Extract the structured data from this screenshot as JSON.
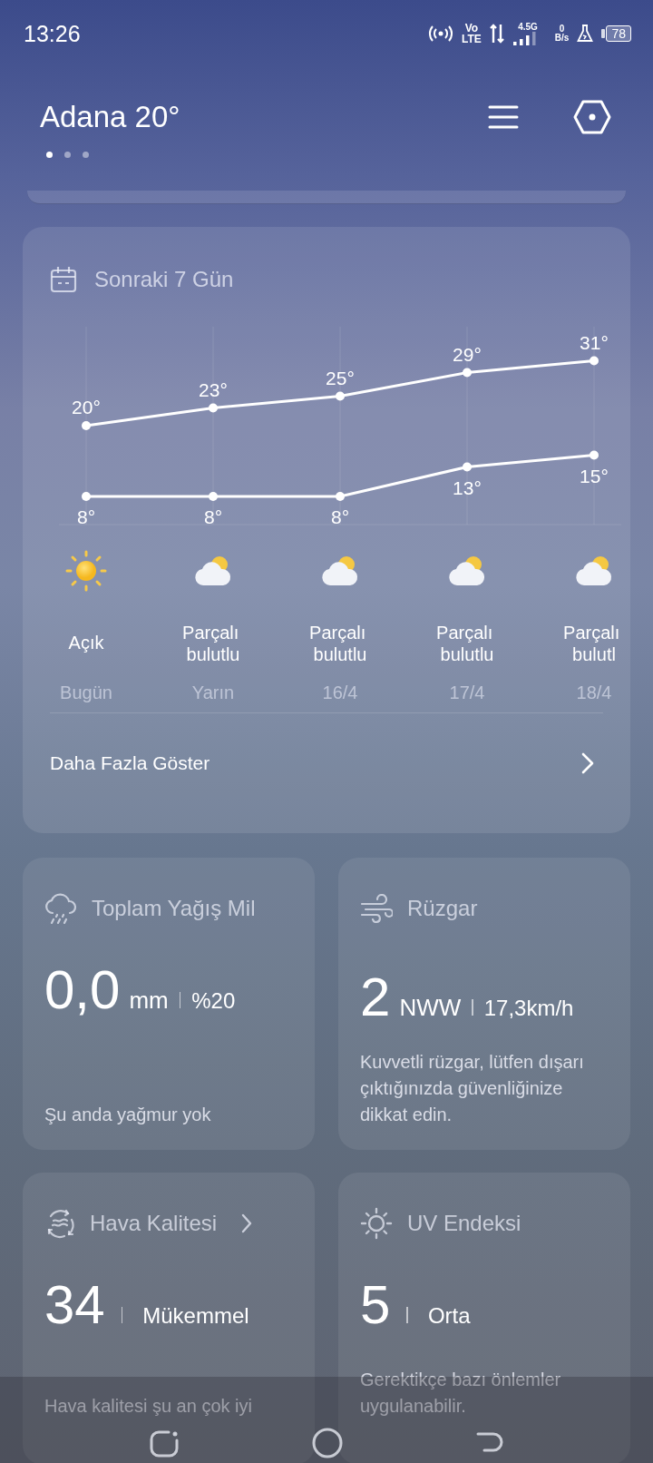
{
  "status_bar": {
    "time": "13:26",
    "volte_top": "Vo",
    "volte_bottom": "LTE",
    "network": "4.5G",
    "speed_value": "0",
    "speed_unit": "B/s",
    "battery": "78"
  },
  "header": {
    "title": "Adana 20°",
    "pages": [
      {
        "selected": true
      },
      {
        "selected": false
      },
      {
        "selected": false
      }
    ]
  },
  "forecast": {
    "title": "Sonraki 7 Gün",
    "chart_data": {
      "type": "line",
      "grid": true,
      "categories": [
        "Bugün",
        "Yarın",
        "16/4",
        "17/4",
        "18/4"
      ],
      "series": [
        {
          "color": "#ffffff",
          "marker": "o",
          "values": [
            20,
            23,
            25,
            29,
            31
          ],
          "value_labels": [
            "20°",
            "23°",
            "25°",
            "29°",
            "31°"
          ]
        },
        {
          "color": "#ffffff",
          "marker": "o",
          "values": [
            8,
            8,
            8,
            13,
            15
          ],
          "value_labels": [
            "8°",
            "8°",
            "8°",
            "13°",
            "15°"
          ]
        }
      ]
    },
    "days": [
      {
        "kind": "sunny",
        "condition": "Açık"
      },
      {
        "kind": "partly_cloudy",
        "condition": "Parçalı bulutlu"
      },
      {
        "kind": "partly_cloudy",
        "condition": "Parçalı bulutlu"
      },
      {
        "kind": "partly_cloudy",
        "condition": "Parçalı bulutlu"
      },
      {
        "kind": "partly_cloudy",
        "condition": "Parçalı bulutl"
      }
    ],
    "more_link": "Daha Fazla Göster"
  },
  "cards": [
    {
      "kind": "rain",
      "title": "Toplam Yağış Mil",
      "chevron": false,
      "value": "0,0",
      "unit": "mm",
      "extra": "%20",
      "note": "Şu anda yağmur yok"
    },
    {
      "kind": "wind",
      "title": "Rüzgar",
      "chevron": false,
      "value": "2",
      "unit": "NWW",
      "extra": "17,3km/h",
      "note": "Kuvvetli rüzgar, lütfen dışarı çıktığınızda güvenliğinize dikkat edin."
    },
    {
      "kind": "air",
      "title": "Hava Kalitesi",
      "chevron": true,
      "value": "34",
      "extra": "Mükemmel",
      "note": "Hava kalitesi şu an çok iyi"
    },
    {
      "kind": "uv",
      "title": "UV Endeksi",
      "chevron": false,
      "value": "5",
      "extra": "Orta",
      "note": "Gerektikçe bazı önlemler uygulanabilir."
    }
  ]
}
